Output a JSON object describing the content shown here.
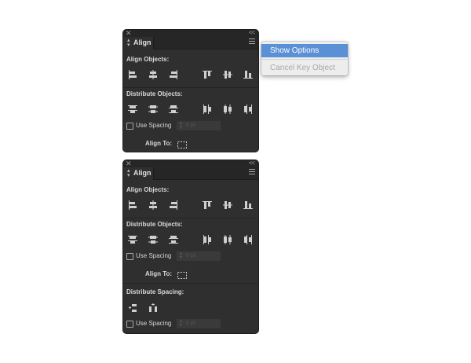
{
  "panels": [
    {
      "id": "panel1",
      "tab_title": "Align",
      "align_objects_label": "Align Objects:",
      "distribute_objects_label": "Distribute Objects:",
      "use_spacing_label": "Use Spacing",
      "spacing_value": "0 pt",
      "align_to_label": "Align To:"
    },
    {
      "id": "panel2",
      "tab_title": "Align",
      "align_objects_label": "Align Objects:",
      "distribute_objects_label": "Distribute Objects:",
      "use_spacing_label": "Use Spacing",
      "spacing_value": "0 pt",
      "align_to_label": "Align To:",
      "distribute_spacing_label": "Distribute Spacing:",
      "use_spacing_label_2": "Use Spacing",
      "spacing_value_2": "0 pt"
    }
  ],
  "dropdown": {
    "items": [
      {
        "label": "Show Options",
        "state": "highlighted"
      },
      {
        "label": "Cancel Key Object",
        "state": "disabled"
      }
    ]
  },
  "colors": {
    "panel_bg": "#2f2f2f",
    "menu_highlight": "#5a90d6",
    "menu_bg": "#ededed"
  }
}
